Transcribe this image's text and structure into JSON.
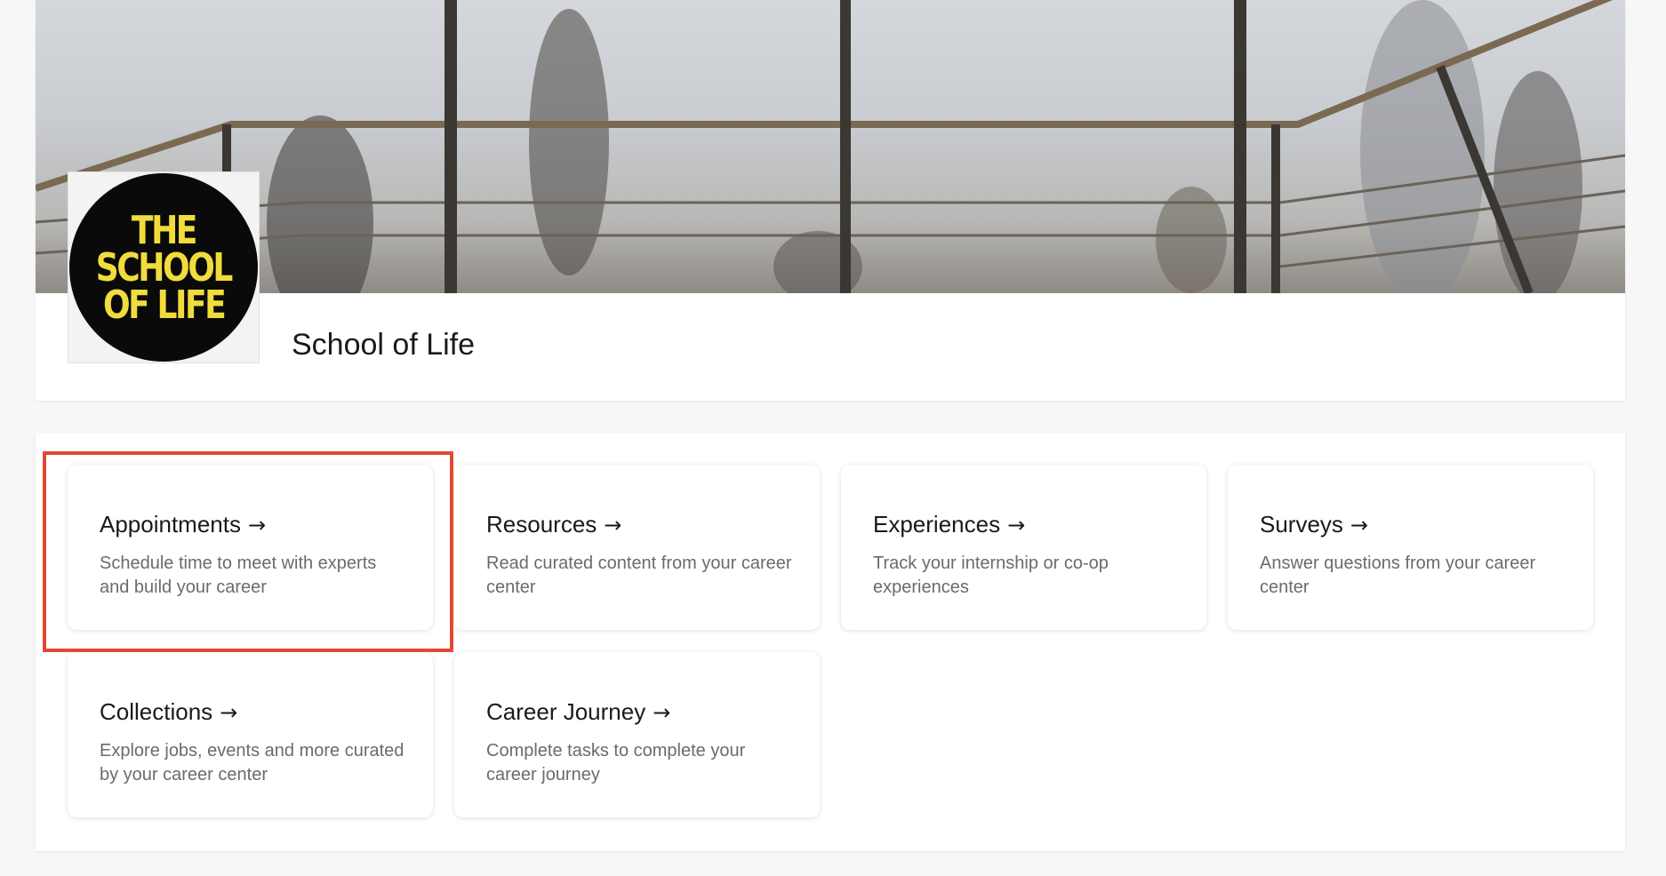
{
  "organization": {
    "name": "School of Life",
    "logo_text": [
      "THE",
      "SCHOOL",
      "OF LIFE"
    ]
  },
  "colors": {
    "highlight": "#e04a33",
    "logo_text": "#f0dc3c",
    "logo_background": "#0a0a0a"
  },
  "tiles": [
    {
      "title": "Appointments",
      "arrow": "→",
      "description": "Schedule time to meet with experts and build your career"
    },
    {
      "title": "Resources",
      "arrow": "→",
      "description": "Read curated content from your career center"
    },
    {
      "title": "Experiences",
      "arrow": "→",
      "description": "Track your internship or co-op experiences"
    },
    {
      "title": "Surveys",
      "arrow": "→",
      "description": "Answer questions from your career center"
    },
    {
      "title": "Collections",
      "arrow": "→",
      "description": "Explore jobs, events and more curated by your career center"
    },
    {
      "title": "Career Journey",
      "arrow": "→",
      "description": "Complete tasks to complete your career journey"
    }
  ],
  "icons": {
    "arrow": "arrow-right-icon"
  }
}
